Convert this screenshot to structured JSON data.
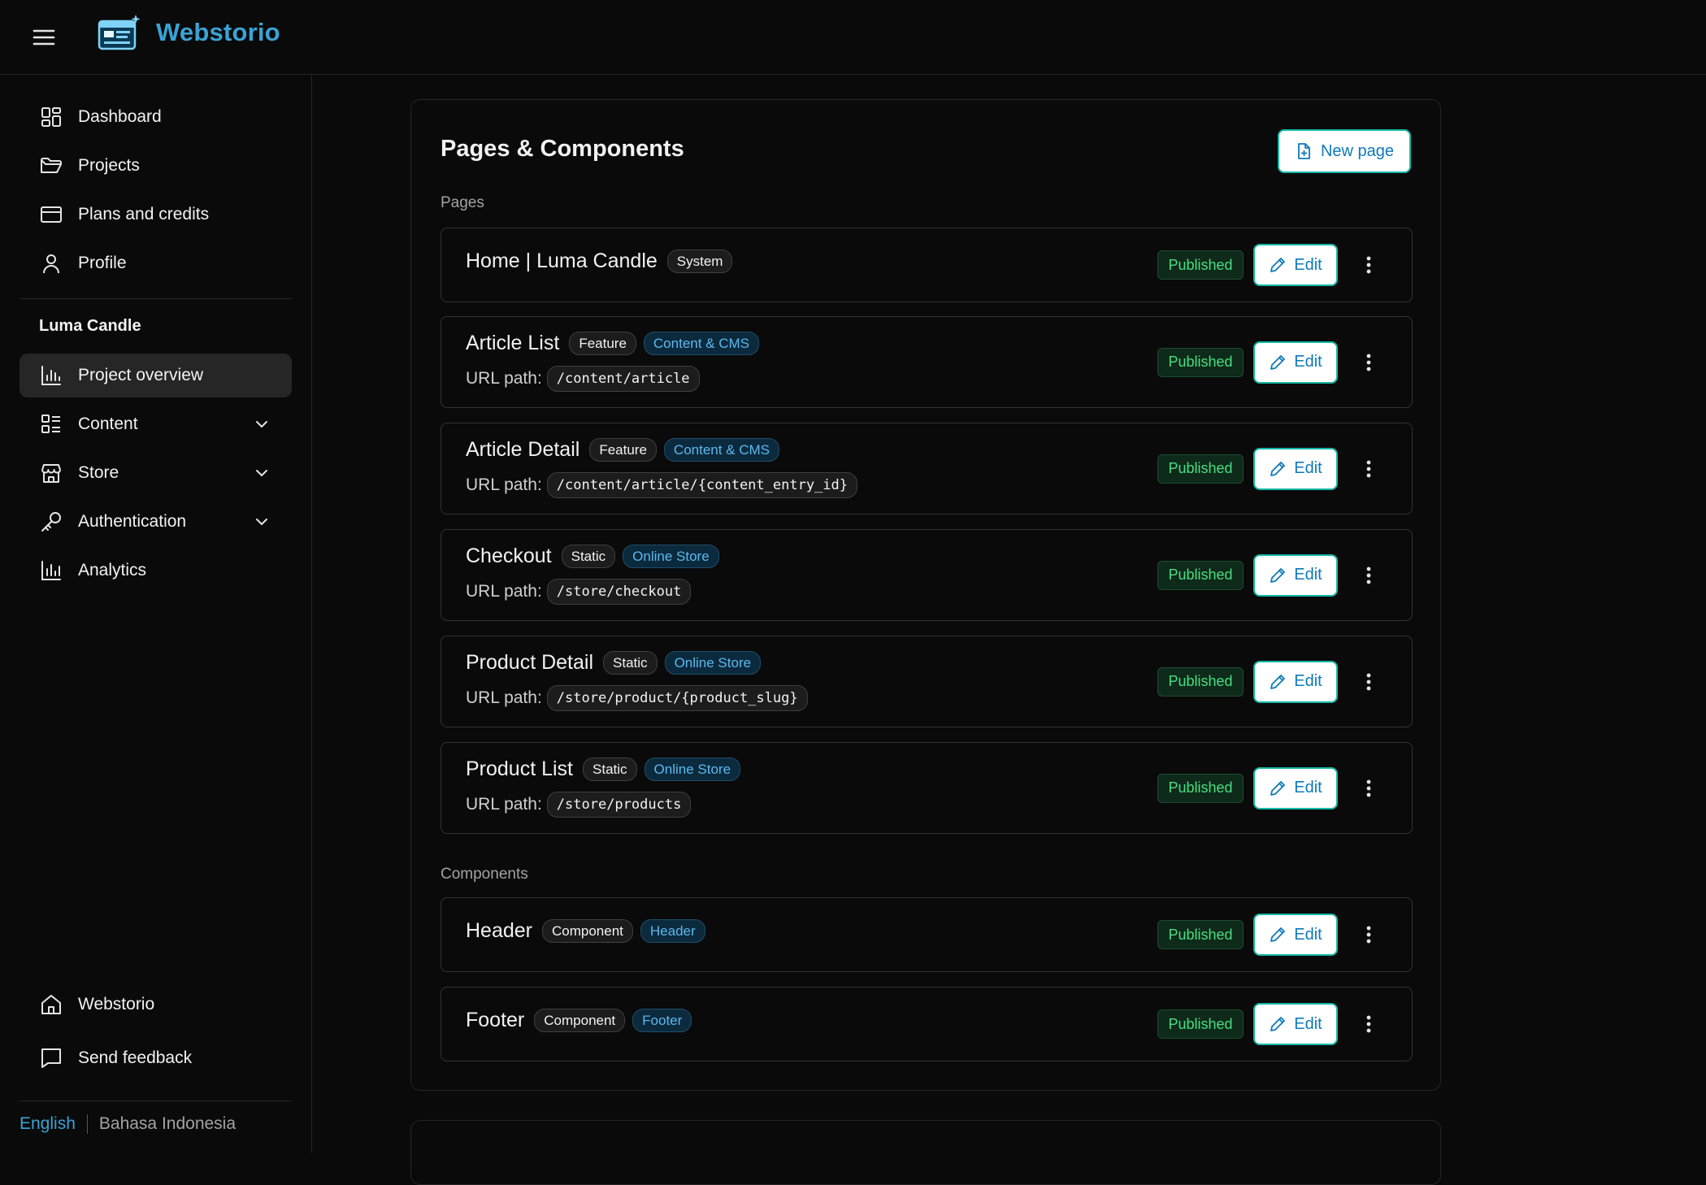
{
  "app": {
    "brand": "Webstorio"
  },
  "sidebar": {
    "items": [
      {
        "label": "Dashboard",
        "icon": "dashboard-icon"
      },
      {
        "label": "Projects",
        "icon": "folder-icon"
      },
      {
        "label": "Plans and credits",
        "icon": "credit-card-icon"
      },
      {
        "label": "Profile",
        "icon": "user-icon"
      }
    ],
    "project_title": "Luma Candle",
    "project_items": [
      {
        "label": "Project overview",
        "icon": "bar-chart-icon",
        "active": true
      },
      {
        "label": "Content",
        "icon": "list-icon",
        "expandable": true
      },
      {
        "label": "Store",
        "icon": "store-icon",
        "expandable": true
      },
      {
        "label": "Authentication",
        "icon": "key-icon",
        "expandable": true
      },
      {
        "label": "Analytics",
        "icon": "analytics-icon"
      }
    ],
    "footer_items": [
      {
        "label": "Webstorio",
        "icon": "home-icon"
      },
      {
        "label": "Send feedback",
        "icon": "message-icon"
      }
    ],
    "languages": {
      "english": "English",
      "indonesian": "Bahasa Indonesia",
      "selected": "English"
    }
  },
  "main": {
    "title": "Pages & Components",
    "new_page_label": "New page",
    "pages_label": "Pages",
    "components_label": "Components",
    "edit_label": "Edit",
    "url_prefix": "URL path:",
    "pages": [
      {
        "name": "Home | Luma Candle",
        "badges": [
          {
            "text": "System",
            "kind": "gray"
          }
        ],
        "url": null,
        "status": "Published"
      },
      {
        "name": "Article List",
        "badges": [
          {
            "text": "Feature",
            "kind": "gray"
          },
          {
            "text": "Content & CMS",
            "kind": "blue"
          }
        ],
        "url": "/content/article",
        "status": "Published"
      },
      {
        "name": "Article Detail",
        "badges": [
          {
            "text": "Feature",
            "kind": "gray"
          },
          {
            "text": "Content & CMS",
            "kind": "blue"
          }
        ],
        "url": "/content/article/{content_entry_id}",
        "status": "Published"
      },
      {
        "name": "Checkout",
        "badges": [
          {
            "text": "Static",
            "kind": "gray"
          },
          {
            "text": "Online Store",
            "kind": "blue"
          }
        ],
        "url": "/store/checkout",
        "status": "Published"
      },
      {
        "name": "Product Detail",
        "badges": [
          {
            "text": "Static",
            "kind": "gray"
          },
          {
            "text": "Online Store",
            "kind": "blue"
          }
        ],
        "url": "/store/product/{product_slug}",
        "status": "Published"
      },
      {
        "name": "Product List",
        "badges": [
          {
            "text": "Static",
            "kind": "gray"
          },
          {
            "text": "Online Store",
            "kind": "blue"
          }
        ],
        "url": "/store/products",
        "status": "Published"
      }
    ],
    "components": [
      {
        "name": "Header",
        "badges": [
          {
            "text": "Component",
            "kind": "gray"
          },
          {
            "text": "Header",
            "kind": "blue"
          }
        ],
        "url": null,
        "status": "Published"
      },
      {
        "name": "Footer",
        "badges": [
          {
            "text": "Component",
            "kind": "gray"
          },
          {
            "text": "Footer",
            "kind": "blue"
          }
        ],
        "url": null,
        "status": "Published"
      }
    ]
  }
}
